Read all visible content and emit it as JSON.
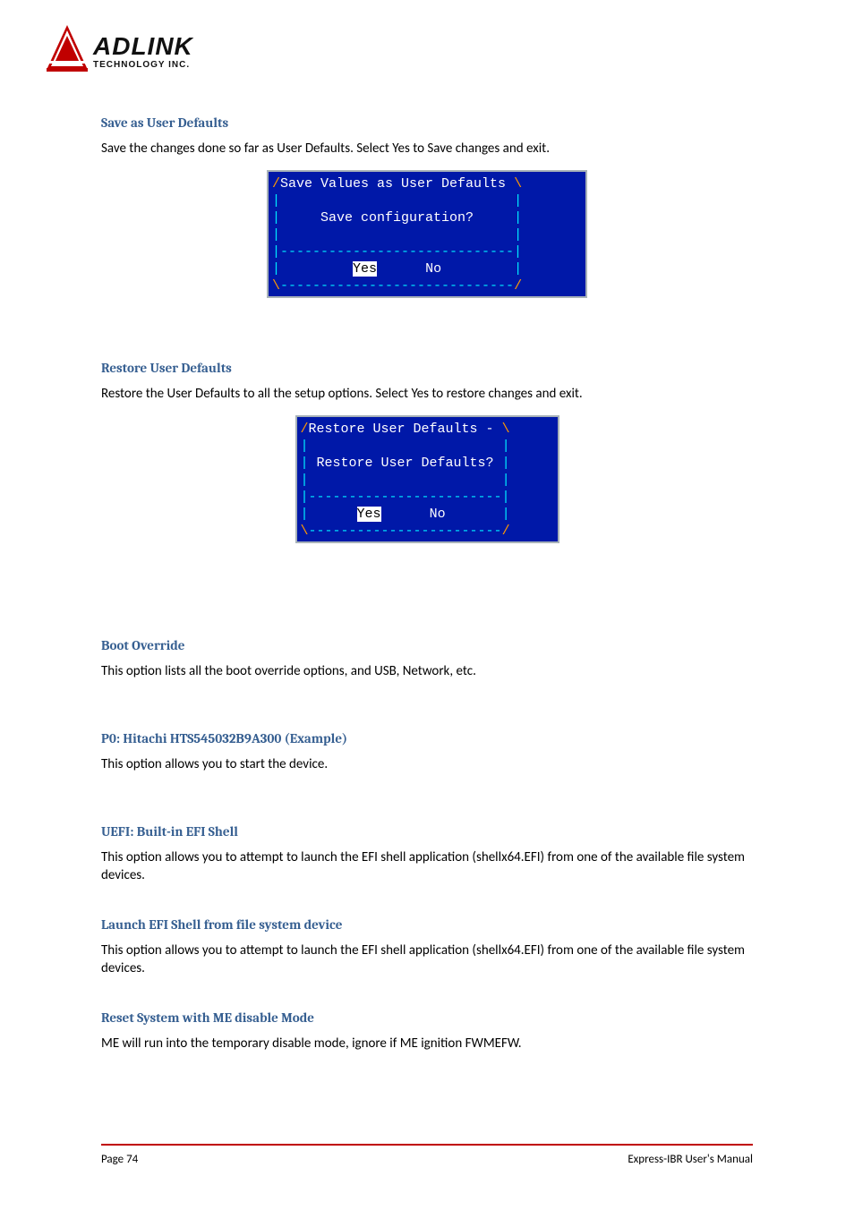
{
  "logo": {
    "main": "ADLINK",
    "sub": "TECHNOLOGY INC."
  },
  "sections": [
    {
      "heading": "Save as User Defaults",
      "body": "Save the changes done so far as User Defaults. Select Yes to Save changes and exit.",
      "dialog": {
        "title": "Save Values as User Defaults",
        "prompt": "Save configuration?",
        "yes": "Yes",
        "no": "No",
        "width": 29
      }
    },
    {
      "heading": "Restore User Defaults",
      "body": "Restore the User Defaults to all the setup options. Select Yes to restore changes and exit.",
      "dialog": {
        "title": "Restore User Defaults -",
        "prompt": "Restore User Defaults?",
        "yes": "Yes",
        "no": "No",
        "width": 24
      }
    },
    {
      "heading": "Boot Override",
      "body": "This option lists all the boot override options, and USB, Network, etc."
    },
    {
      "heading": "P0: Hitachi HTS545032B9A300 (Example)",
      "body": "This option allows you to start the device."
    },
    {
      "heading": "UEFI: Built-in EFI Shell",
      "body": "This option allows you to attempt to launch the EFI shell application (shellx64.EFI) from one of the available file system devices."
    },
    {
      "heading": "Launch EFI Shell from file system device",
      "body": "This option allows you to attempt to launch the EFI shell application (shellx64.EFI) from one of the available file system devices."
    },
    {
      "heading": "Reset System with ME disable Mode",
      "body": "ME will run into the temporary disable mode, ignore if ME ignition FWMEFW."
    }
  ],
  "footer": {
    "left": "Page 74",
    "right": "Express-IBR User's Manual"
  }
}
